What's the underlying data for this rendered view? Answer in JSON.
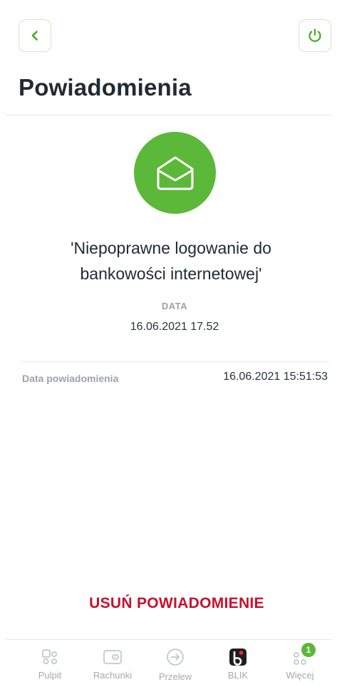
{
  "header": {
    "title": "Powiadomienia",
    "back_icon": "chevron-left-icon",
    "power_icon": "power-icon"
  },
  "notification": {
    "icon": "envelope-open-icon",
    "title": "'Niepoprawne logowanie do bankowości internetowej'",
    "data_label": "DATA",
    "data_value": "16.06.2021 17.52",
    "detail_label": "Data powiadomienia",
    "detail_value": "16.06.2021 15:51:53"
  },
  "actions": {
    "delete_label": "USUŃ POWIADOMIENIE"
  },
  "tabbar": {
    "items": [
      {
        "label": "Pulpit",
        "icon": "dashboard-icon"
      },
      {
        "label": "Rachunki",
        "icon": "wallet-icon"
      },
      {
        "label": "Przelew",
        "icon": "transfer-icon"
      },
      {
        "label": "BLIK",
        "icon": "blik-icon"
      },
      {
        "label": "Więcej",
        "icon": "more-icon",
        "badge": "1"
      }
    ]
  },
  "colors": {
    "accent_green": "#5cb838",
    "danger_red": "#c8102e"
  }
}
